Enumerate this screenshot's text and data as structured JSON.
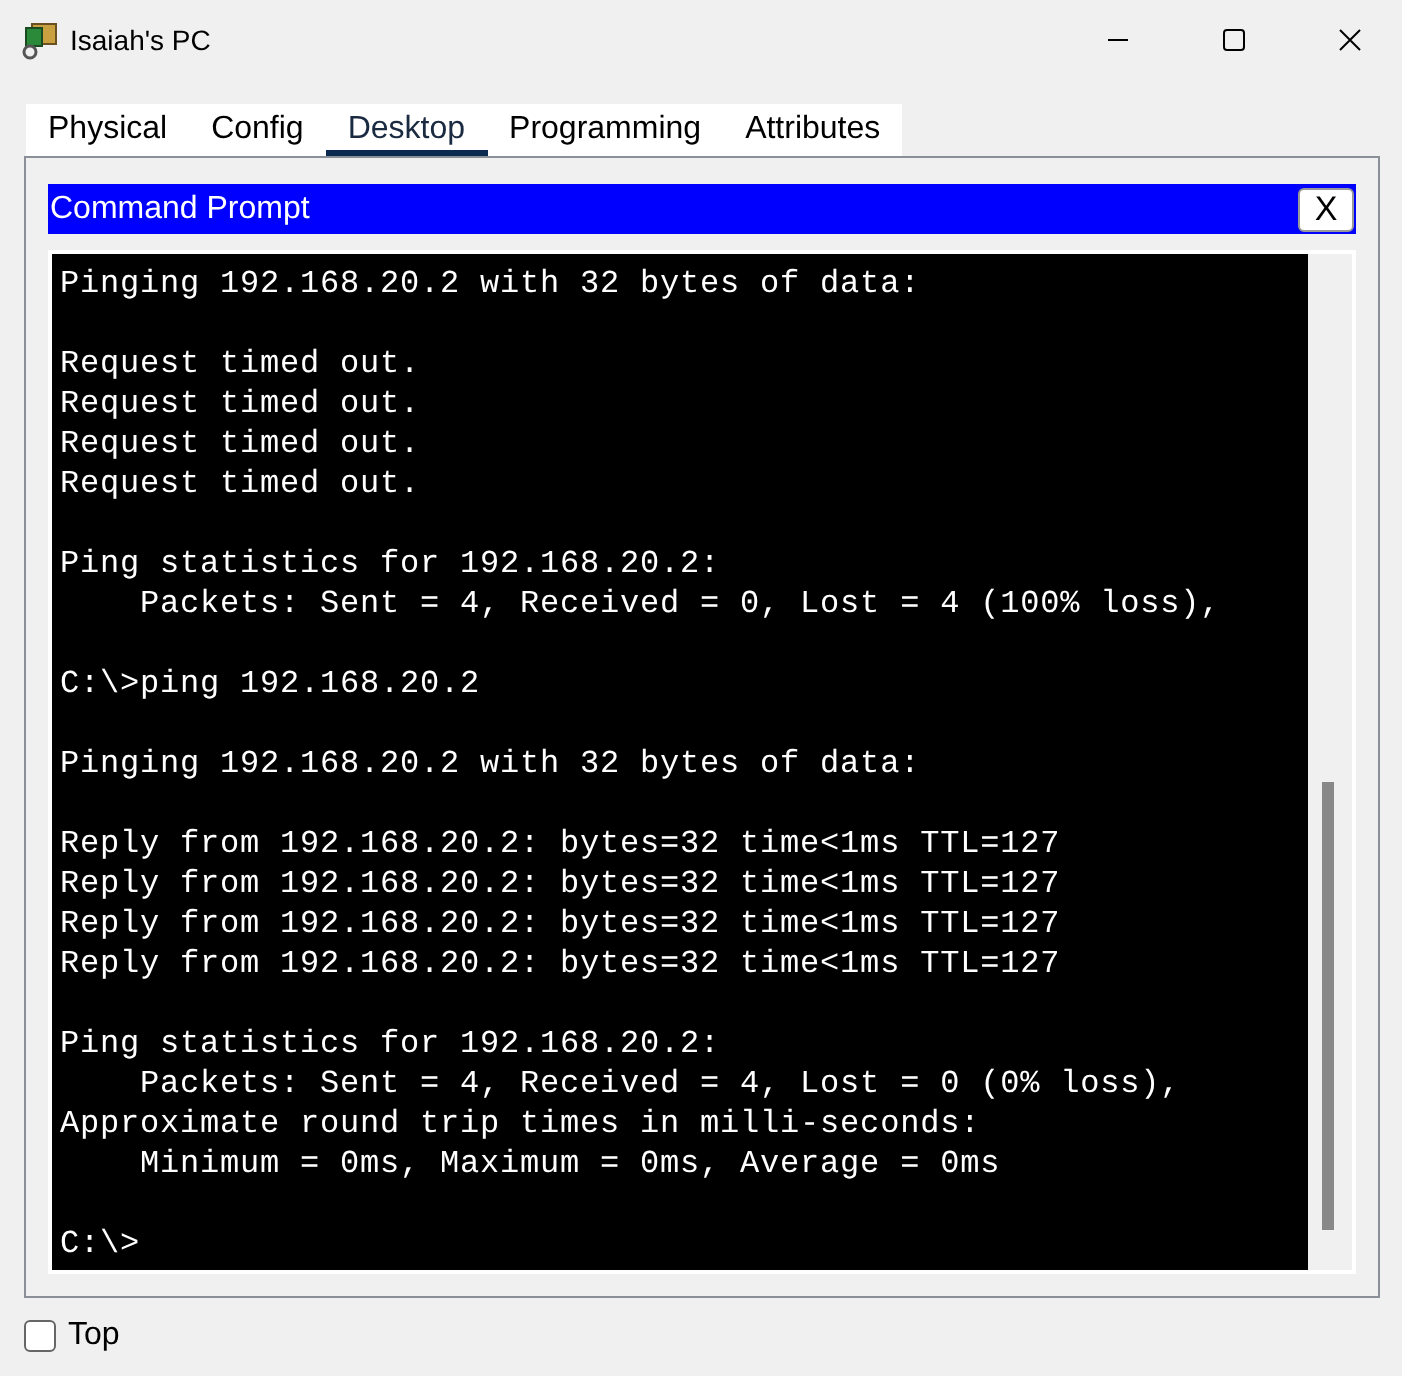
{
  "window": {
    "title": "Isaiah's PC"
  },
  "tabs": [
    {
      "label": "Physical",
      "selected": false
    },
    {
      "label": "Config",
      "selected": false
    },
    {
      "label": "Desktop",
      "selected": true
    },
    {
      "label": "Programming",
      "selected": false
    },
    {
      "label": "Attributes",
      "selected": false
    }
  ],
  "command_prompt": {
    "title": "Command Prompt",
    "close_label": "X",
    "output_blocks": [
      [
        "Pinging 192.168.20.2 with 32 bytes of data:"
      ],
      [
        "Request timed out.",
        "Request timed out.",
        "Request timed out.",
        "Request timed out."
      ],
      [
        "Ping statistics for 192.168.20.2:",
        "    Packets: Sent = 4, Received = 0, Lost = 4 (100% loss),"
      ],
      [
        "C:\\>ping 192.168.20.2"
      ],
      [
        "Pinging 192.168.20.2 with 32 bytes of data:"
      ],
      [
        "Reply from 192.168.20.2: bytes=32 time<1ms TTL=127",
        "Reply from 192.168.20.2: bytes=32 time<1ms TTL=127",
        "Reply from 192.168.20.2: bytes=32 time<1ms TTL=127",
        "Reply from 192.168.20.2: bytes=32 time<1ms TTL=127"
      ],
      [
        "Ping statistics for 192.168.20.2:",
        "    Packets: Sent = 4, Received = 4, Lost = 0 (0% loss),",
        "Approximate round trip times in milli-seconds:",
        "    Minimum = 0ms, Maximum = 0ms, Average = 0ms"
      ],
      [
        "C:\\>"
      ]
    ]
  },
  "top_option": {
    "label": "Top",
    "checked": false
  }
}
